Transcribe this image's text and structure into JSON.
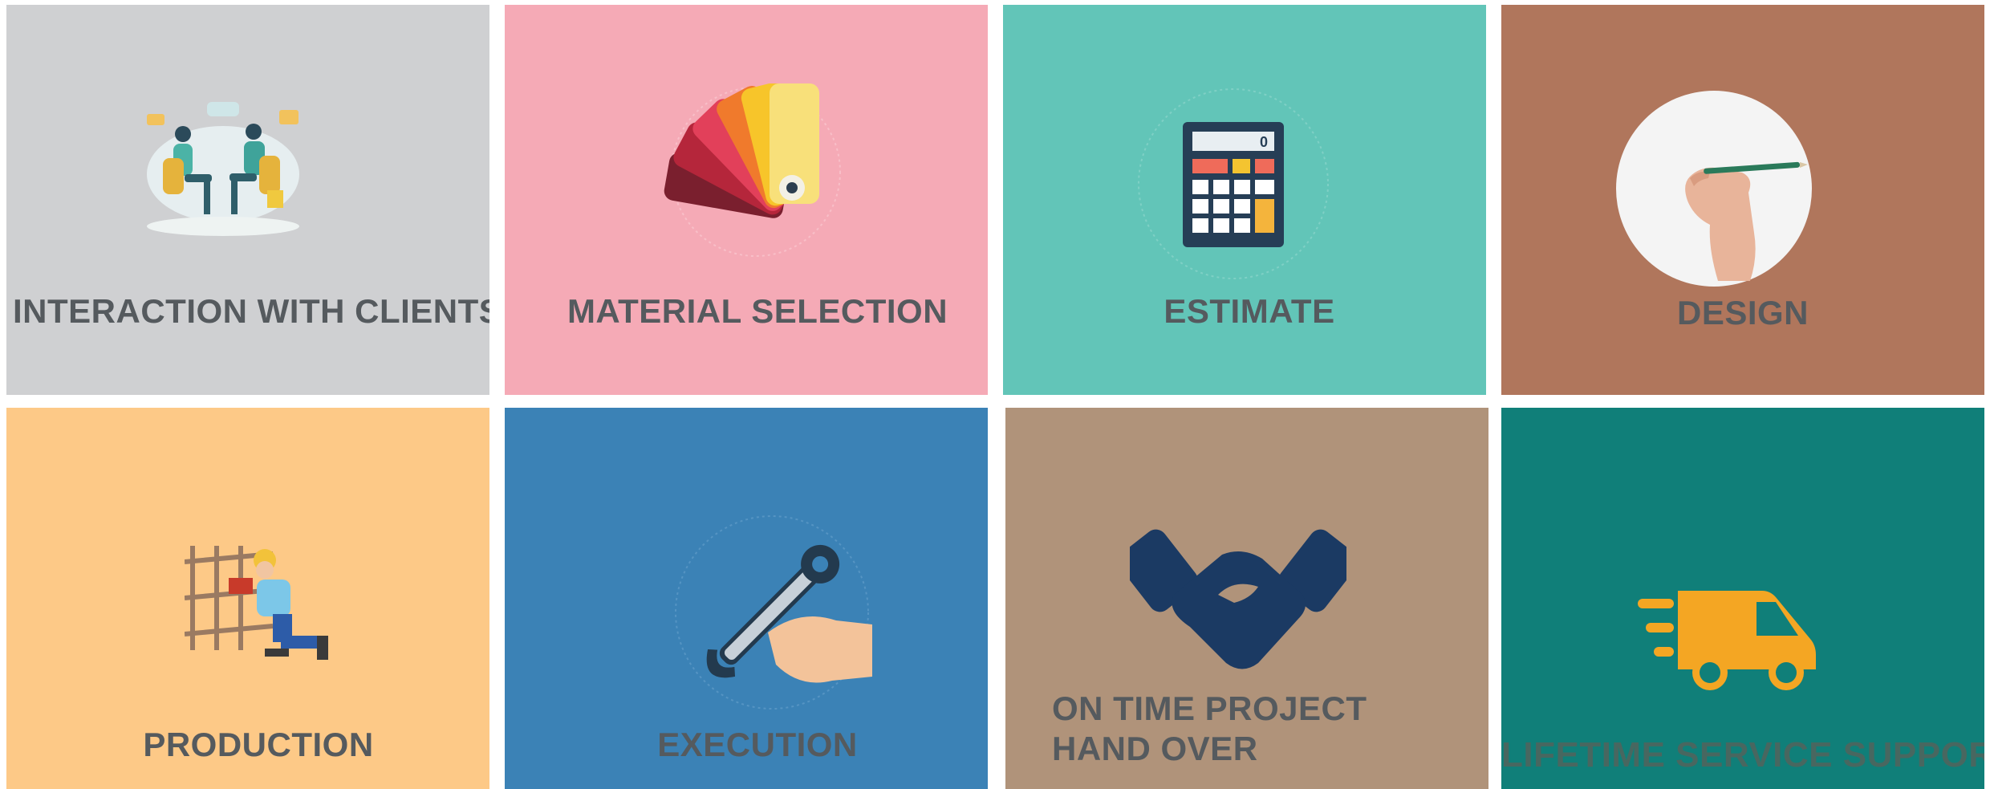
{
  "tiles": [
    {
      "label": "INTERACTION WITH CLIENTS",
      "color": "#cfd0d2",
      "icon": "client-meeting-icon"
    },
    {
      "label": "MATERIAL SELECTION",
      "color": "#f5aab6",
      "icon": "color-swatch-icon"
    },
    {
      "label": "ESTIMATE",
      "color": "#62c5b8",
      "icon": "calculator-icon"
    },
    {
      "label": "DESIGN",
      "color": "#b0765c",
      "icon": "hand-drawing-icon"
    },
    {
      "label": "PRODUCTION",
      "color": "#fdc987",
      "icon": "worker-icon"
    },
    {
      "label": "EXECUTION",
      "color": "#3b82b6",
      "icon": "wrench-hand-icon"
    },
    {
      "label": "ON TIME PROJECT\n HAND OVER",
      "color": "#b0937a",
      "icon": "handshake-icon"
    },
    {
      "label": "LIFETIME SERVICE SUPPORT",
      "color": "#107f79",
      "icon": "delivery-van-icon"
    }
  ],
  "calculator": {
    "display": "0"
  }
}
